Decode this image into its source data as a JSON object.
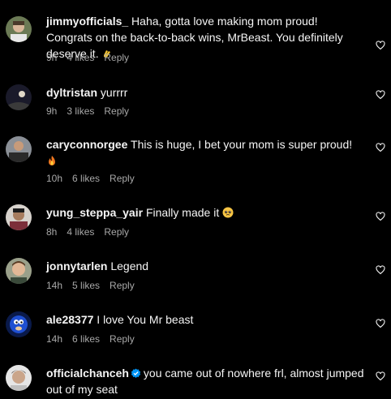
{
  "comments": [
    {
      "username": "jimmyofficials_",
      "text": " Haha, gotta love making mom proud! Congrats on the back-to-back wins, MrBeast. You definitely deserve it. ",
      "emoji": "clapping-hands-emoji",
      "time": "9h",
      "likes": "4 likes",
      "reply": "Reply"
    },
    {
      "username": "dyltristan",
      "text": " yurrrr",
      "time": "9h",
      "likes": "3 likes",
      "reply": "Reply"
    },
    {
      "username": "caryconnorgee",
      "text": " This is huge, I bet your mom is super proud!",
      "emoji": "fire-emoji",
      "time": "10h",
      "likes": "6 likes",
      "reply": "Reply"
    },
    {
      "username": "yung_steppa_yair",
      "text": " Finally made it ",
      "emoji": "pleading-face-emoji",
      "time": "8h",
      "likes": "4 likes",
      "reply": "Reply"
    },
    {
      "username": "jonnytarlen",
      "text": " Legend",
      "time": "14h",
      "likes": "5 likes",
      "reply": "Reply"
    },
    {
      "username": "ale28377",
      "text": " I love You Mr beast",
      "time": "14h",
      "likes": "6 likes",
      "reply": "Reply"
    },
    {
      "username": "officialchanceh",
      "verified": "verified-badge-icon",
      "text": "you came out of nowhere frl, almost jumped out of my seat"
    }
  ],
  "colors": {
    "background": "#000000",
    "primary_text": "#f5f5f5",
    "secondary_text": "#a8a8a8",
    "verified_blue": "#0095f6"
  }
}
